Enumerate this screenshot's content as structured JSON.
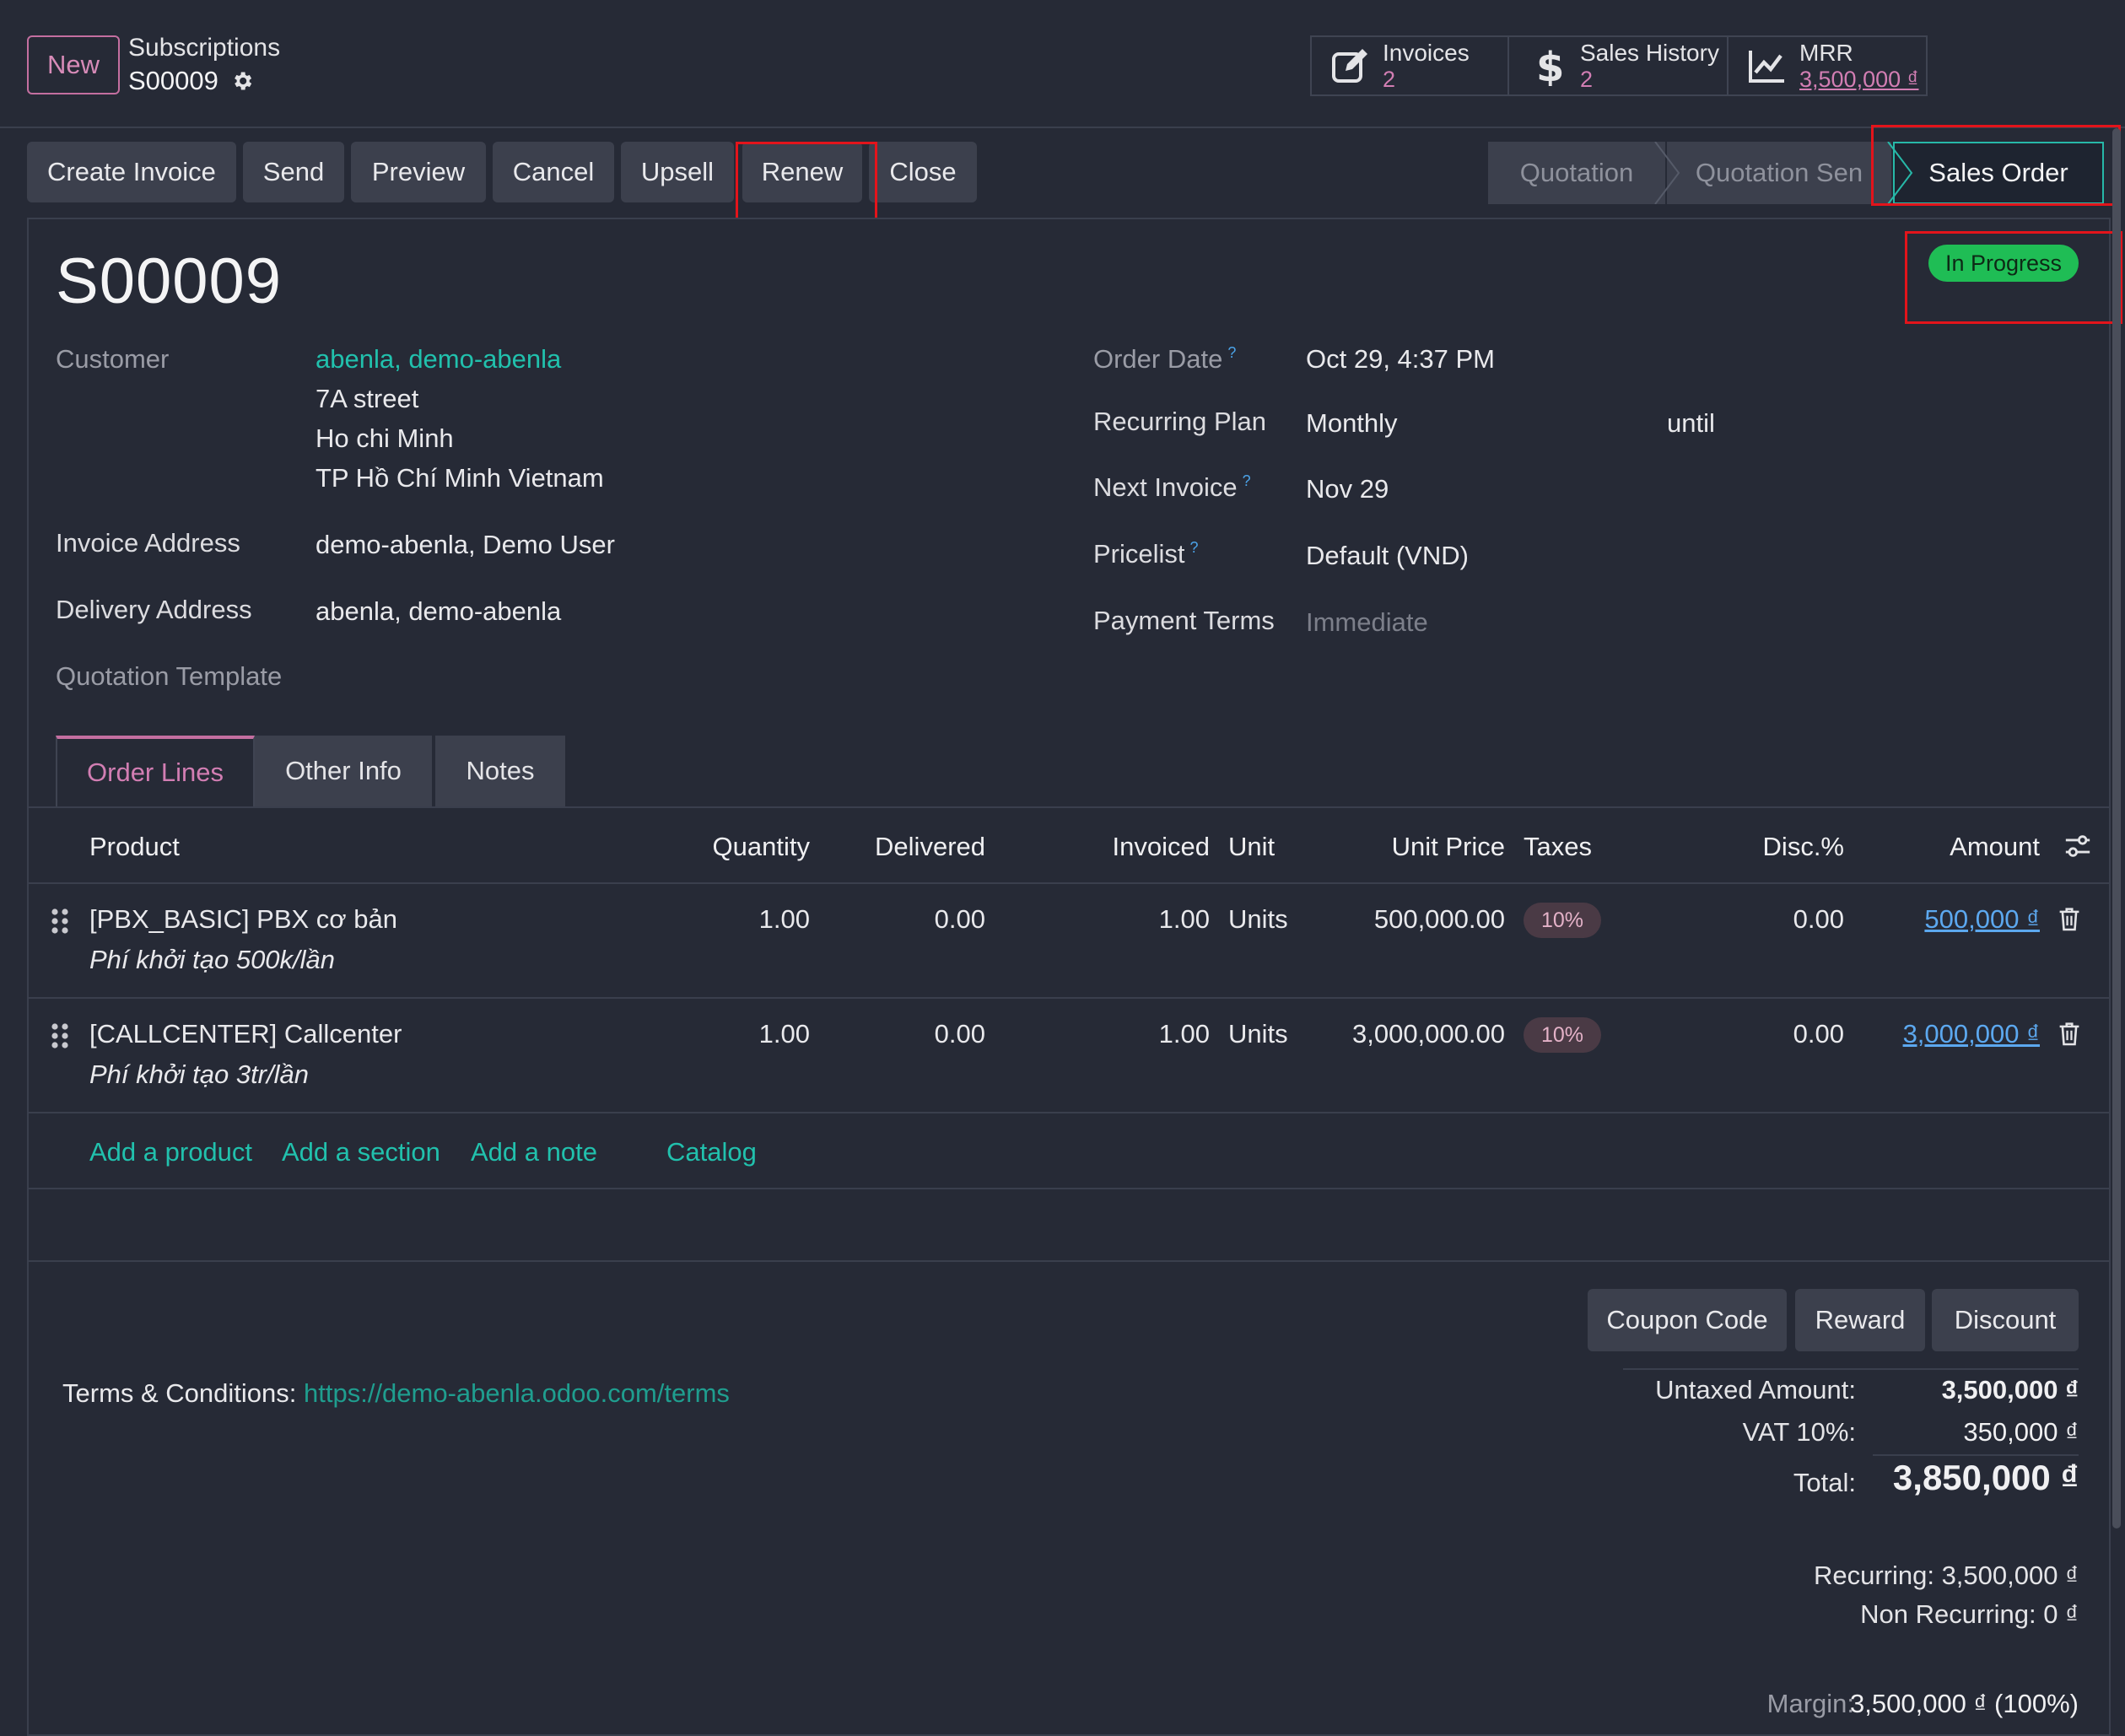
{
  "control_panel": {
    "new_label": "New",
    "breadcrumb_parent": "Subscriptions",
    "breadcrumb_current": "S00009",
    "smart_buttons": [
      {
        "label": "Invoices",
        "value": "2",
        "icon": "pencil-square-icon"
      },
      {
        "label": "Sales History",
        "value": "2",
        "icon": "dollar-icon"
      },
      {
        "label": "MRR",
        "value": "3,500,000 ₫",
        "icon": "line-chart-icon"
      }
    ]
  },
  "actions": [
    "Create Invoice",
    "Send",
    "Preview",
    "Cancel",
    "Upsell",
    "Renew",
    "Close"
  ],
  "status_bar": {
    "stages": [
      "Quotation",
      "Quotation Sent",
      "Sales Order"
    ],
    "stage_visible": [
      "Quotation",
      "Quotation Sen",
      "Sales Order"
    ],
    "active": "Sales Order"
  },
  "record": {
    "name": "S00009",
    "state_badge": "In Progress",
    "left_fields": {
      "customer_label": "Customer",
      "customer_name": "abenla, demo-abenla",
      "customer_addr1": "7A street",
      "customer_addr2": "Ho chi Minh",
      "customer_addr3": "TP Hồ Chí Minh Vietnam",
      "invoice_address_label": "Invoice Address",
      "invoice_address": "demo-abenla, Demo User",
      "delivery_address_label": "Delivery Address",
      "delivery_address": "abenla, demo-abenla",
      "quotation_template_label": "Quotation Template"
    },
    "right_fields": {
      "order_date_label": "Order Date",
      "order_date": "Oct 29, 4:37 PM",
      "recurring_plan_label": "Recurring Plan",
      "recurring_plan": "Monthly",
      "until_label": "until",
      "next_invoice_label": "Next Invoice",
      "next_invoice": "Nov 29",
      "pricelist_label": "Pricelist",
      "pricelist": "Default (VND)",
      "payment_terms_label": "Payment Terms",
      "payment_terms_placeholder": "Immediate",
      "help_mark": "?"
    }
  },
  "tabs": [
    "Order Lines",
    "Other Info",
    "Notes"
  ],
  "order_lines": {
    "columns": [
      "Product",
      "Quantity",
      "Delivered",
      "Invoiced",
      "Unit",
      "Unit Price",
      "Taxes",
      "Disc.%",
      "Amount"
    ],
    "rows": [
      {
        "product": "[PBX_BASIC] PBX cơ bản",
        "description": "Phí khởi tạo 500k/lần",
        "quantity": "1.00",
        "delivered": "0.00",
        "invoiced": "1.00",
        "unit": "Units",
        "unit_price": "500,000.00",
        "tax": "10%",
        "discount": "0.00",
        "amount": "500,000 ₫"
      },
      {
        "product": "[CALLCENTER] Callcenter",
        "description": "Phí khởi tạo 3tr/lần",
        "quantity": "1.00",
        "delivered": "0.00",
        "invoiced": "1.00",
        "unit": "Units",
        "unit_price": "3,000,000.00",
        "tax": "10%",
        "discount": "0.00",
        "amount": "3,000,000 ₫"
      }
    ],
    "add_links": [
      "Add a product",
      "Add a section",
      "Add a note",
      "Catalog"
    ]
  },
  "promo_buttons": [
    "Coupon Code",
    "Reward",
    "Discount"
  ],
  "terms": {
    "label": "Terms & Conditions:",
    "url": "https://demo-abenla.odoo.com/terms"
  },
  "totals": {
    "untaxed_label": "Untaxed Amount:",
    "untaxed": "3,500,000 ₫",
    "vat_label": "VAT 10%:",
    "vat": "350,000 ₫",
    "total_label": "Total:",
    "total": "3,850,000 ₫",
    "recurring": "Recurring: 3,500,000 ₫",
    "non_recurring": "Non Recurring: 0 ₫",
    "margin_label": "Margin:",
    "margin": "3,500,000 ₫ (100%)"
  },
  "colors": {
    "background": "#262a36",
    "button": "#3c404d",
    "accent_pink": "#c46fa0",
    "link_teal": "#21c1ad",
    "badge_green": "#1fbd55",
    "amount_blue": "#5ca8ef",
    "highlight_red": "#e3141b"
  }
}
